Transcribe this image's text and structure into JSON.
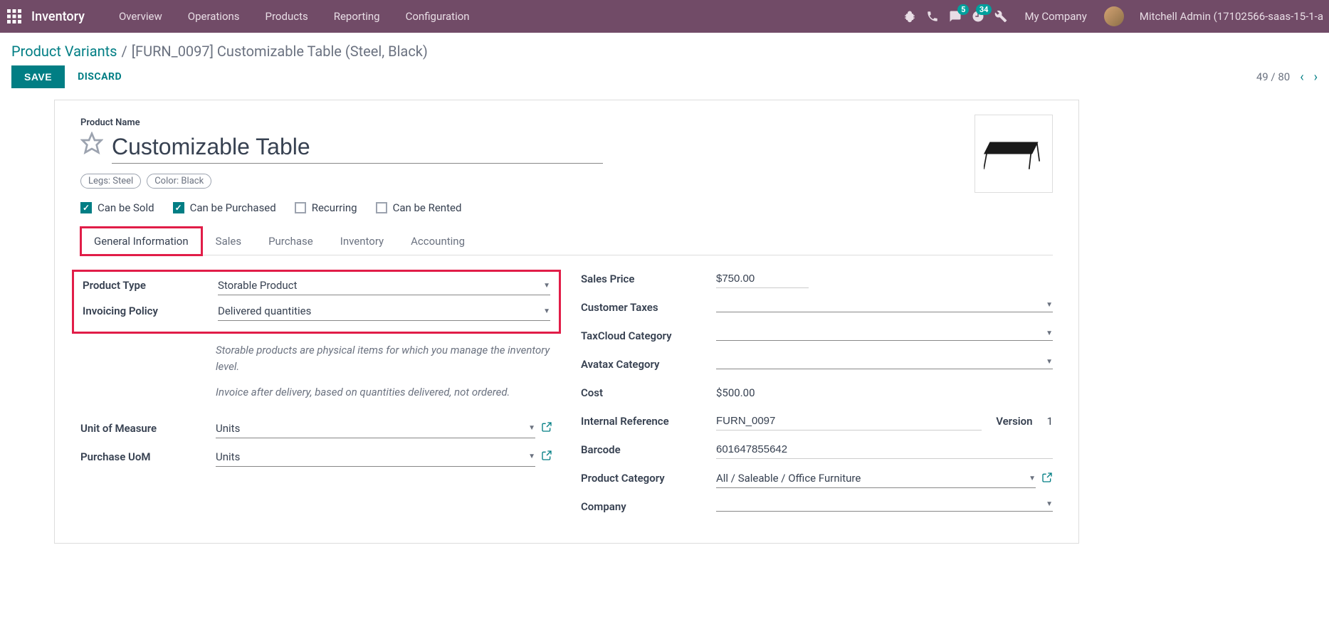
{
  "nav": {
    "brand": "Inventory",
    "items": [
      "Overview",
      "Operations",
      "Products",
      "Reporting",
      "Configuration"
    ],
    "msg_badge": "5",
    "activity_badge": "34",
    "company": "My Company",
    "user": "Mitchell Admin (17102566-saas-15-1-a"
  },
  "breadcrumb": {
    "parent": "Product Variants",
    "current": "[FURN_0097] Customizable Table (Steel, Black)"
  },
  "actions": {
    "save": "SAVE",
    "discard": "DISCARD",
    "pager": "49 / 80"
  },
  "product": {
    "name_label": "Product Name",
    "name": "Customizable Table",
    "tags": [
      "Legs: Steel",
      "Color: Black"
    ],
    "checkboxes": [
      {
        "label": "Can be Sold",
        "checked": true
      },
      {
        "label": "Can be Purchased",
        "checked": true
      },
      {
        "label": "Recurring",
        "checked": false
      },
      {
        "label": "Can be Rented",
        "checked": false
      }
    ]
  },
  "tabs": [
    "General Information",
    "Sales",
    "Purchase",
    "Inventory",
    "Accounting"
  ],
  "left_fields": {
    "product_type_label": "Product Type",
    "product_type_value": "Storable Product",
    "invoicing_policy_label": "Invoicing Policy",
    "invoicing_policy_value": "Delivered quantities",
    "help1": "Storable products are physical items for which you manage the inventory level.",
    "help2": "Invoice after delivery, based on quantities delivered, not ordered.",
    "uom_label": "Unit of Measure",
    "uom_value": "Units",
    "purchase_uom_label": "Purchase UoM",
    "purchase_uom_value": "Units"
  },
  "right_fields": {
    "sales_price_label": "Sales Price",
    "sales_price_value": "$750.00",
    "customer_taxes_label": "Customer Taxes",
    "taxcloud_label": "TaxCloud Category",
    "avatax_label": "Avatax Category",
    "cost_label": "Cost",
    "cost_value": "$500.00",
    "internal_ref_label": "Internal Reference",
    "internal_ref_value": "FURN_0097",
    "version_label": "Version",
    "version_value": "1",
    "barcode_label": "Barcode",
    "barcode_value": "601647855642",
    "category_label": "Product Category",
    "category_value": "All / Saleable / Office Furniture",
    "company_label": "Company"
  }
}
